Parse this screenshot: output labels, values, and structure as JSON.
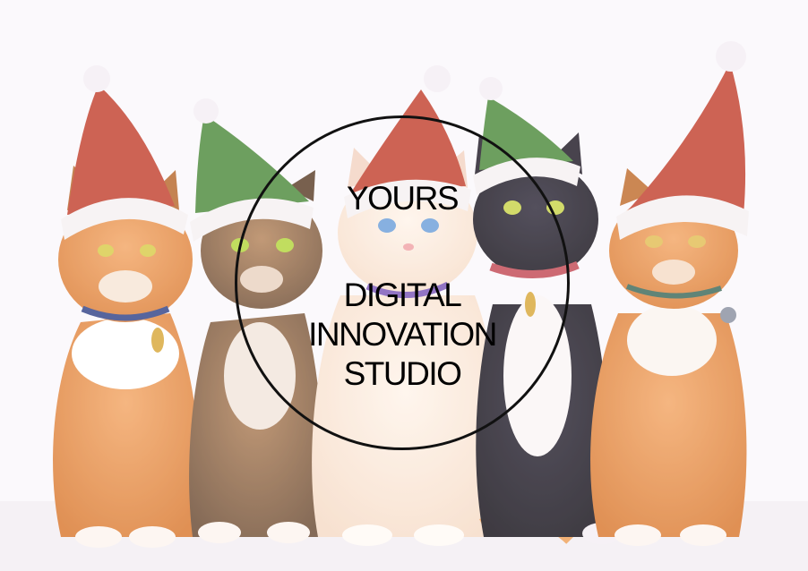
{
  "logo": {
    "top_word": "YOURS",
    "lines": [
      "DIGITAL",
      "INNOVATION",
      "STUDIO"
    ]
  },
  "colors": {
    "background": "#fbf8fc",
    "logo_ink": "#000000",
    "santa_hat": "#c2412f",
    "elf_hat": "#4e8a3c"
  }
}
